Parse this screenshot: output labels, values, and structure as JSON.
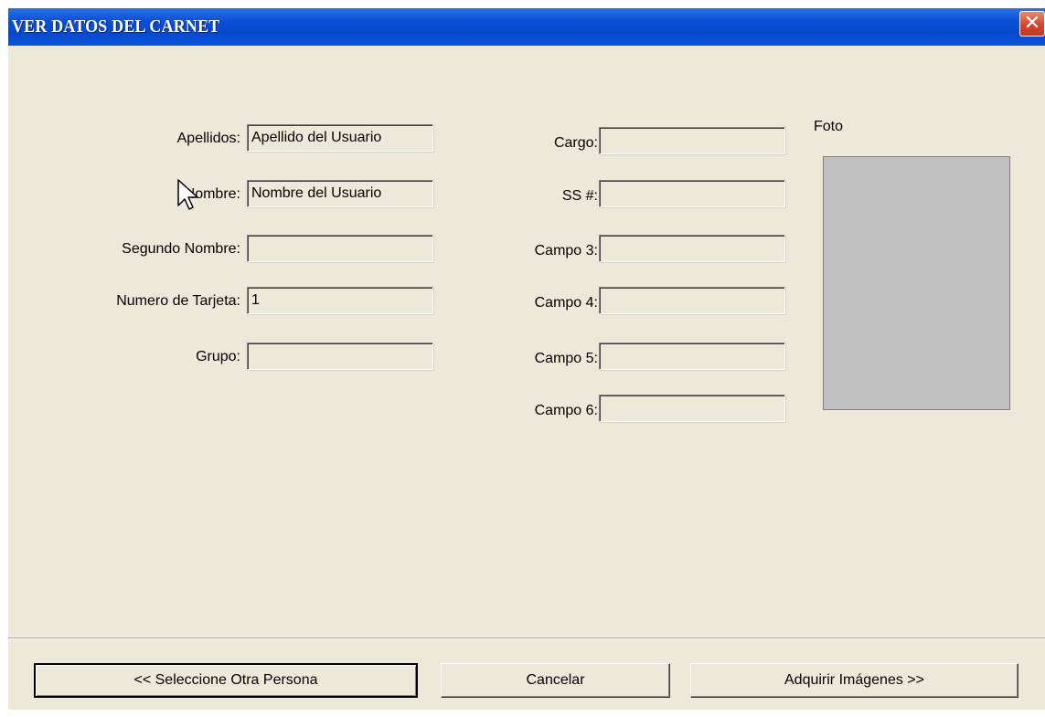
{
  "window": {
    "title": "VER DATOS DEL CARNET",
    "close_glyph": "✕"
  },
  "left_fields": [
    {
      "label": "Apellidos:",
      "value": "Apellido del Usuario"
    },
    {
      "label": "Nombre:",
      "value": "Nombre del Usuario"
    },
    {
      "label": "Segundo Nombre:",
      "value": ""
    },
    {
      "label": "Numero de Tarjeta:",
      "value": "1"
    },
    {
      "label": "Grupo:",
      "value": ""
    }
  ],
  "middle_fields": [
    {
      "label": "Cargo:",
      "value": ""
    },
    {
      "label": "SS #:",
      "value": ""
    },
    {
      "label": "Campo 3:",
      "value": ""
    },
    {
      "label": "Campo 4:",
      "value": ""
    },
    {
      "label": "Campo 5:",
      "value": ""
    },
    {
      "label": "Campo 6:",
      "value": ""
    }
  ],
  "photo": {
    "label": "Foto"
  },
  "buttons": {
    "select_other": "<< Seleccione Otra Persona",
    "cancel": "Cancelar",
    "acquire": "Adquirir Imágenes >>"
  },
  "colors": {
    "titlebar": "#0a4fd6",
    "dialog_bg": "#ece9d8",
    "photo_bg": "#c0c0c0",
    "close": "#d2452c"
  },
  "icons": {
    "close": "close-icon",
    "cursor": "mouse-pointer-icon"
  }
}
